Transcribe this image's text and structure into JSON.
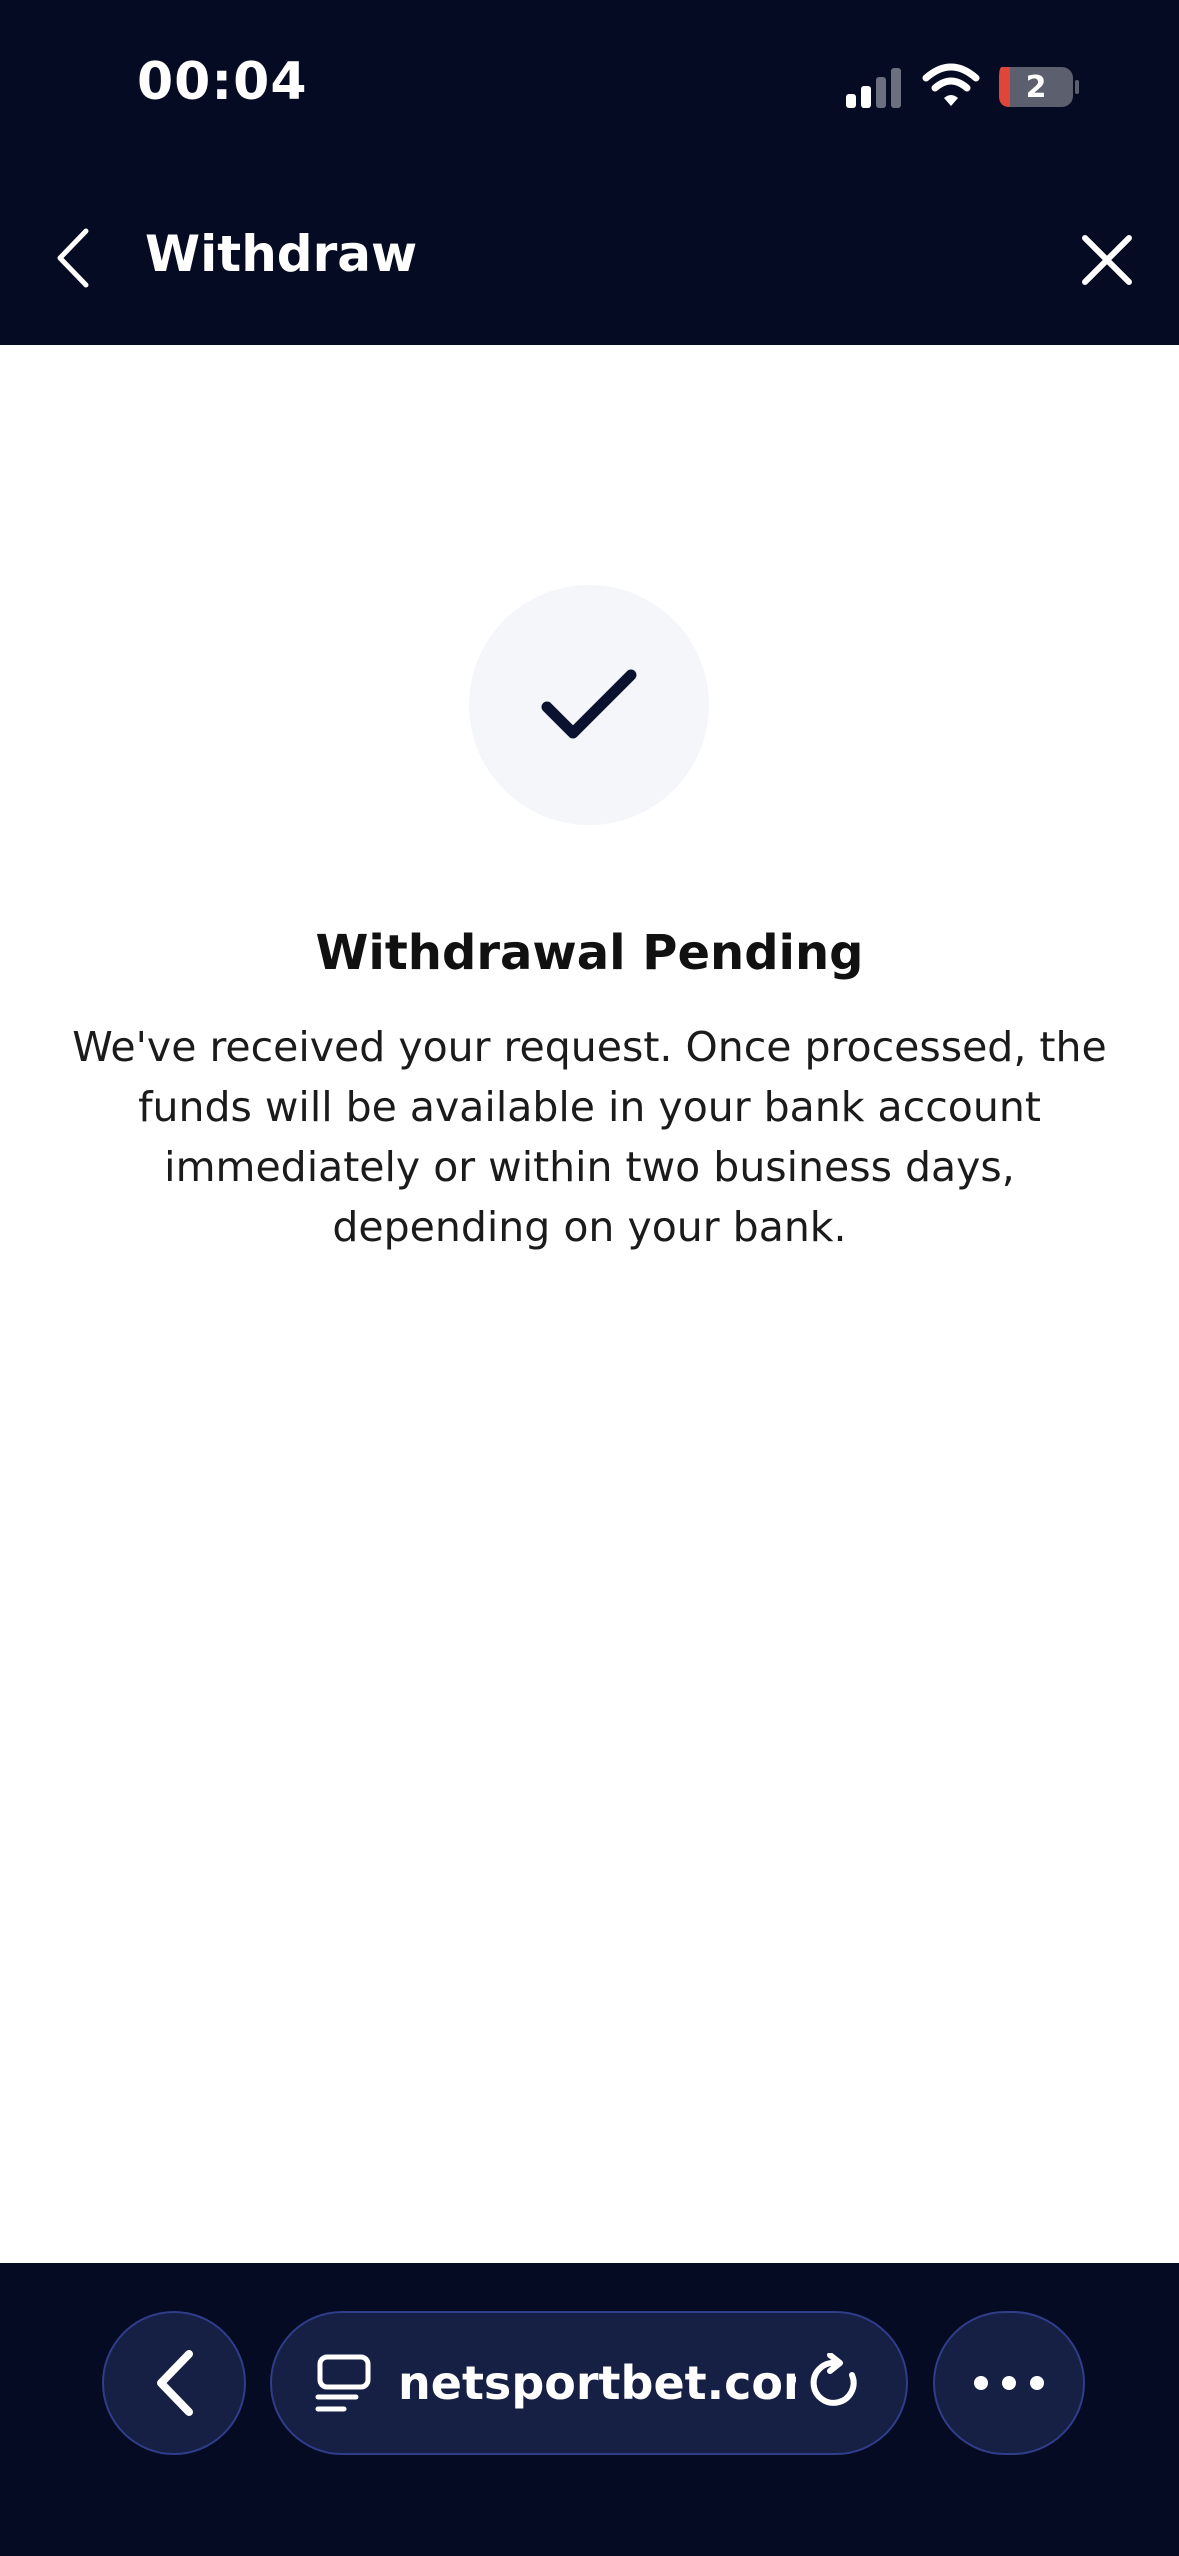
{
  "status_bar": {
    "time": "00:04",
    "battery_level": "2",
    "colors": {
      "background": "#050b22",
      "text": "#ffffff"
    },
    "icons": [
      "cellular-signal-icon",
      "wifi-icon",
      "battery-icon"
    ]
  },
  "nav": {
    "title": "Withdraw",
    "icons": [
      "chevron-left-icon",
      "close-icon"
    ]
  },
  "confirmation": {
    "icon": "checkmark-icon",
    "title": "Withdrawal Pending",
    "message": "We've received your request. Once processed, the funds will be available in your bank account immediately or within two business days, depending on your bank."
  },
  "browser": {
    "url": "netsportbet.com",
    "icons": [
      "chevron-left-icon",
      "tabs-icon",
      "reload-icon",
      "more-icon"
    ],
    "colors": {
      "background": "#050b22",
      "pill": "#162045",
      "pill_border": "#2f3d8a"
    }
  }
}
